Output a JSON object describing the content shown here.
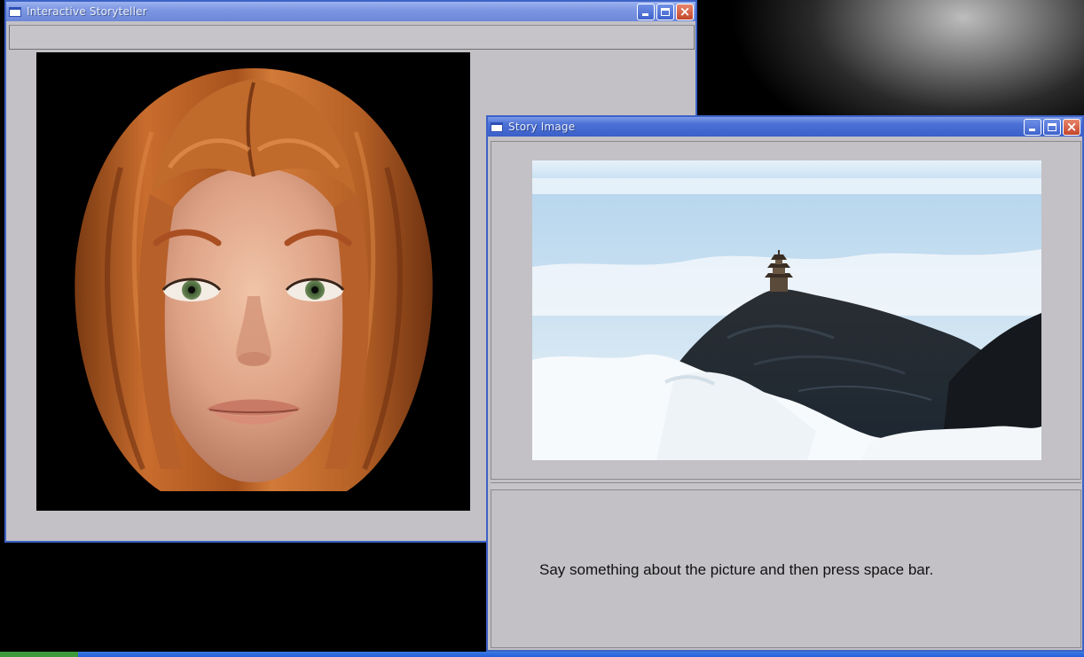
{
  "desktop": {
    "background": "#000000"
  },
  "storyteller_window": {
    "title": "Interactive Storyteller",
    "icon": "app-window-icon",
    "controls": [
      "minimize-icon",
      "maximize-icon",
      "close-icon"
    ]
  },
  "story_image_window": {
    "title": "Story Image",
    "icon": "app-window-icon",
    "controls": [
      "minimize-icon",
      "maximize-icon",
      "close-icon"
    ],
    "photo": "pagoda-on-mountain-above-clouds",
    "prompt": "Say something about the picture and then press space bar."
  },
  "colors": {
    "titlebar_active": "#3a5fc8",
    "window_body": "#c3c1c6",
    "close_button": "#c4462b",
    "hair": "#b8612a",
    "skin": "#e0ac90"
  }
}
